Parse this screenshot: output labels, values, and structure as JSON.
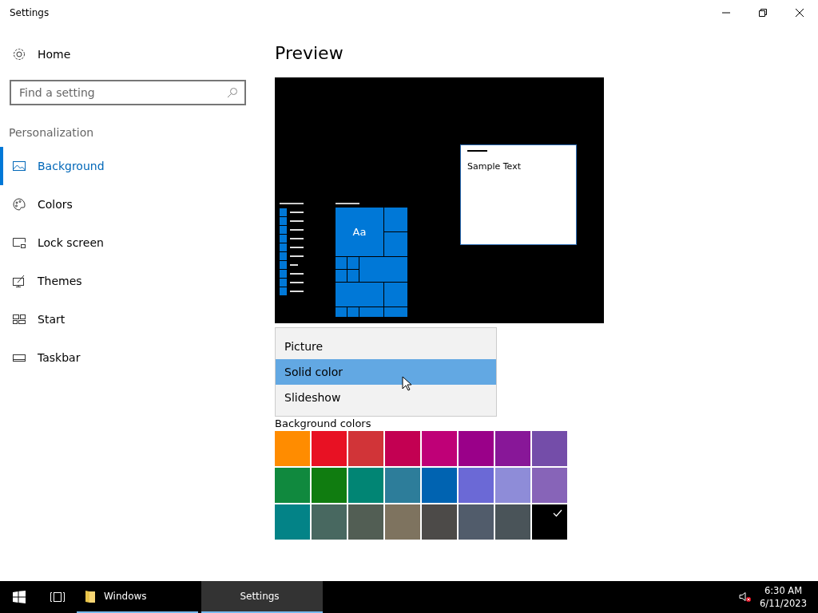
{
  "window": {
    "title": "Settings"
  },
  "sidebar": {
    "home": "Home",
    "search": {
      "placeholder": "Find a setting"
    },
    "section": "Personalization",
    "items": [
      {
        "label": "Background",
        "kind": "background",
        "selected": true
      },
      {
        "label": "Colors",
        "kind": "colors",
        "selected": false
      },
      {
        "label": "Lock screen",
        "kind": "lock",
        "selected": false
      },
      {
        "label": "Themes",
        "kind": "themes",
        "selected": false
      },
      {
        "label": "Start",
        "kind": "start",
        "selected": false
      },
      {
        "label": "Taskbar",
        "kind": "taskbar",
        "selected": false
      }
    ]
  },
  "content": {
    "heading": "Preview",
    "preview": {
      "tile_text": "Aa",
      "window_text": "Sample Text"
    },
    "dropdown": {
      "options": [
        {
          "label": "Picture",
          "selected": false
        },
        {
          "label": "Solid color",
          "selected": true
        },
        {
          "label": "Slideshow",
          "selected": false
        }
      ]
    },
    "colors_label": "Background colors",
    "swatches": [
      {
        "color": "#ff8c00",
        "selected": false
      },
      {
        "color": "#e81123",
        "selected": false
      },
      {
        "color": "#d13438",
        "selected": false
      },
      {
        "color": "#c30052",
        "selected": false
      },
      {
        "color": "#bf0077",
        "selected": false
      },
      {
        "color": "#9a0089",
        "selected": false
      },
      {
        "color": "#881798",
        "selected": false
      },
      {
        "color": "#744da9",
        "selected": false
      },
      {
        "color": "#10893e",
        "selected": false
      },
      {
        "color": "#107c10",
        "selected": false
      },
      {
        "color": "#018574",
        "selected": false
      },
      {
        "color": "#2d7d9a",
        "selected": false
      },
      {
        "color": "#0063b1",
        "selected": false
      },
      {
        "color": "#6b69d6",
        "selected": false
      },
      {
        "color": "#8e8cd8",
        "selected": false
      },
      {
        "color": "#8764b8",
        "selected": false
      },
      {
        "color": "#038387",
        "selected": false
      },
      {
        "color": "#486860",
        "selected": false
      },
      {
        "color": "#525e54",
        "selected": false
      },
      {
        "color": "#7e735f",
        "selected": false
      },
      {
        "color": "#4c4a48",
        "selected": false
      },
      {
        "color": "#515c6b",
        "selected": false
      },
      {
        "color": "#4a5459",
        "selected": false
      },
      {
        "color": "#000000",
        "selected": true
      }
    ]
  },
  "taskbar": {
    "apps": [
      {
        "label": "Windows",
        "kind": "folder",
        "selected": false
      },
      {
        "label": "Settings",
        "kind": "plain",
        "selected": true
      }
    ],
    "time": "6:30 AM",
    "date": "6/11/2023"
  }
}
